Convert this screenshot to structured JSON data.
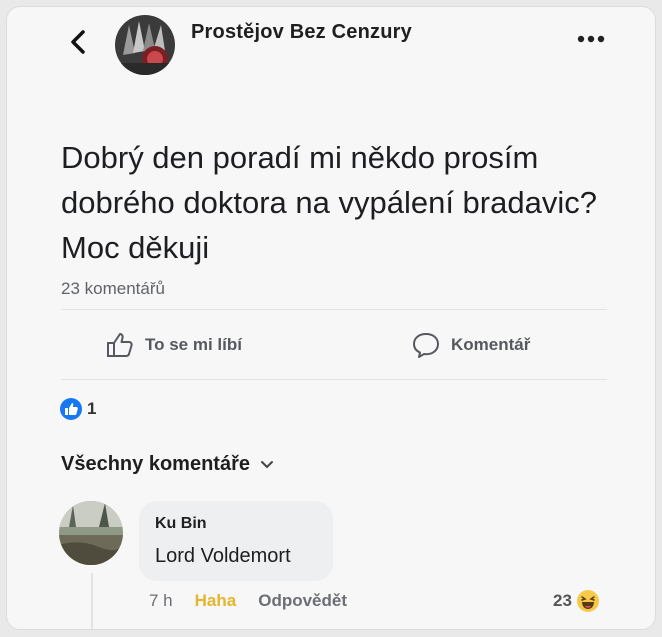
{
  "header": {
    "page_name": "Prostějov Bez Cenzury"
  },
  "post": {
    "text": "Dobrý den poradí mi někdo prosím dobrého doktora na vypálení bradavic?Moc děkuji",
    "comment_count_label": "23 komentářů"
  },
  "actions": {
    "like_label": "To se mi líbí",
    "comment_label": "Komentář"
  },
  "reactions": {
    "count": "1",
    "icon": "like-reaction-icon",
    "color": "#1877f2"
  },
  "comments_section": {
    "filter_label": "Všechny komentáře"
  },
  "comments": [
    {
      "author": "Ku Bin",
      "text": "Lord Voldemort",
      "time": "7 h",
      "reaction_label": "Haha",
      "reply_label": "Odpovědět",
      "reaction_count": "23",
      "reaction_icon": "haha-emoji-icon"
    }
  ],
  "colors": {
    "haha": "#e4b62c",
    "muted": "#6b6f75"
  }
}
